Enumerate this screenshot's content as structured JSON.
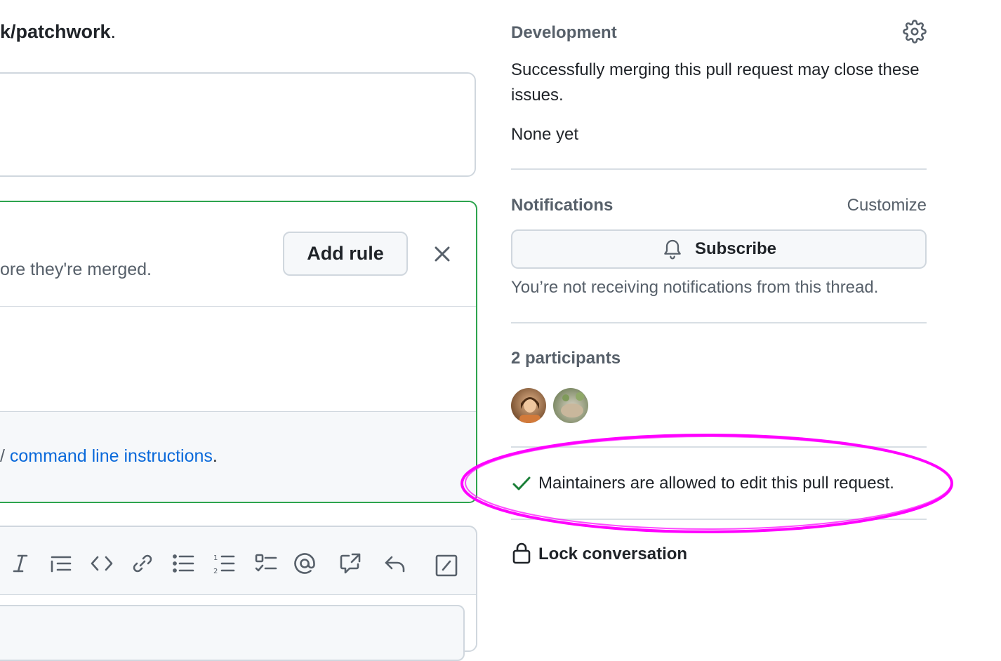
{
  "left": {
    "repo_path": "k/patchwork",
    "repo_period": ".",
    "merge_hint": "ore they're merged.",
    "add_rule_label": "Add rule",
    "cli_prefix": "/ ",
    "cli_link": "command line instructions",
    "cli_suffix": ".",
    "toolbar_icons": [
      "italic-icon",
      "quote-icon",
      "code-icon",
      "link-icon",
      "unordered-list-icon",
      "ordered-list-icon",
      "task-list-icon",
      "mention-icon",
      "cross-reference-icon",
      "reply-icon",
      "slash-command-icon"
    ]
  },
  "sidebar": {
    "development": {
      "title": "Development",
      "description": "Successfully merging this pull request may close these issues.",
      "none": "None yet"
    },
    "notifications": {
      "title": "Notifications",
      "customize": "Customize",
      "subscribe_label": "Subscribe",
      "status": "You’re not receiving notifications from this thread."
    },
    "participants": {
      "title": "2 participants"
    },
    "maintainers_text": "Maintainers are allowed to edit this pull request.",
    "lock_label": "Lock conversation"
  },
  "colors": {
    "accent_link": "#0969da",
    "success_green": "#1a7f37",
    "annotation_magenta": "#ff00ff",
    "border": "#d0d7de"
  }
}
